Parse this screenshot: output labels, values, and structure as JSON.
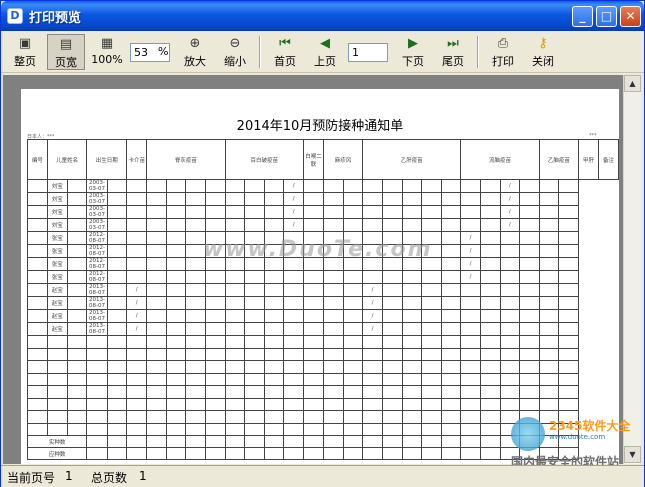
{
  "window": {
    "title": "打印预览"
  },
  "toolbar": {
    "whole_page": "整页",
    "page_width": "页宽",
    "percent_100": "100%",
    "zoom_value": "53",
    "zoom_unit": "%",
    "zoom_in": "放大",
    "zoom_out": "缩小",
    "first_page": "首页",
    "prev_page": "上页",
    "page_value": "1",
    "next_page": "下页",
    "last_page": "尾页",
    "print": "打印",
    "close": "关闭"
  },
  "document": {
    "title": "2014年10月预防接种通知单",
    "header_left": "日本人：***",
    "header_right": "***",
    "columns_row1": [
      "编号",
      "儿童姓名",
      "出生日期",
      "卡介苗",
      "脊灰疫苗",
      "百白破疫苗",
      "白喉二联",
      "麻疹风",
      "乙肝疫苗",
      "流脑疫苗",
      "乙脑疫苗",
      "甲肝",
      "备注"
    ],
    "rows": [
      {
        "name": "刘宝",
        "dob": "2003-03-07",
        "col": "白喉"
      },
      {
        "name": "刘宝",
        "dob": "2003-03-07",
        "col": "白喉"
      },
      {
        "name": "刘宝",
        "dob": "2003-03-07",
        "col": "白喉"
      },
      {
        "name": "刘宝",
        "dob": "2003-03-07",
        "col": "白喉"
      },
      {
        "name": "张宝",
        "dob": "2012-08-07",
        "col": "流脑"
      },
      {
        "name": "张宝",
        "dob": "2012-08-07",
        "col": "流脑"
      },
      {
        "name": "张宝",
        "dob": "2012-08-07",
        "col": "流脑"
      },
      {
        "name": "张宝",
        "dob": "2012-08-07",
        "col": "流脑"
      },
      {
        "name": "赵宝",
        "dob": "2013-08-07",
        "col": "卡介"
      },
      {
        "name": "赵宝",
        "dob": "2013-08-07",
        "col": "卡介"
      },
      {
        "name": "赵宝",
        "dob": "2013-08-07",
        "col": "卡介"
      },
      {
        "name": "赵宝",
        "dob": "2013-08-07",
        "col": "卡介"
      }
    ],
    "footer_actual": "实种数",
    "footer_due": "应种数",
    "watermark": "www.DuoTe.com"
  },
  "status": {
    "current_page_label": "当前页号",
    "current_page_value": "1",
    "total_pages_label": "总页数",
    "total_pages_value": "1"
  },
  "logo": {
    "brand": "2345软件大全",
    "site": "www.duote.com",
    "slogan": "国内最安全的软件站"
  }
}
